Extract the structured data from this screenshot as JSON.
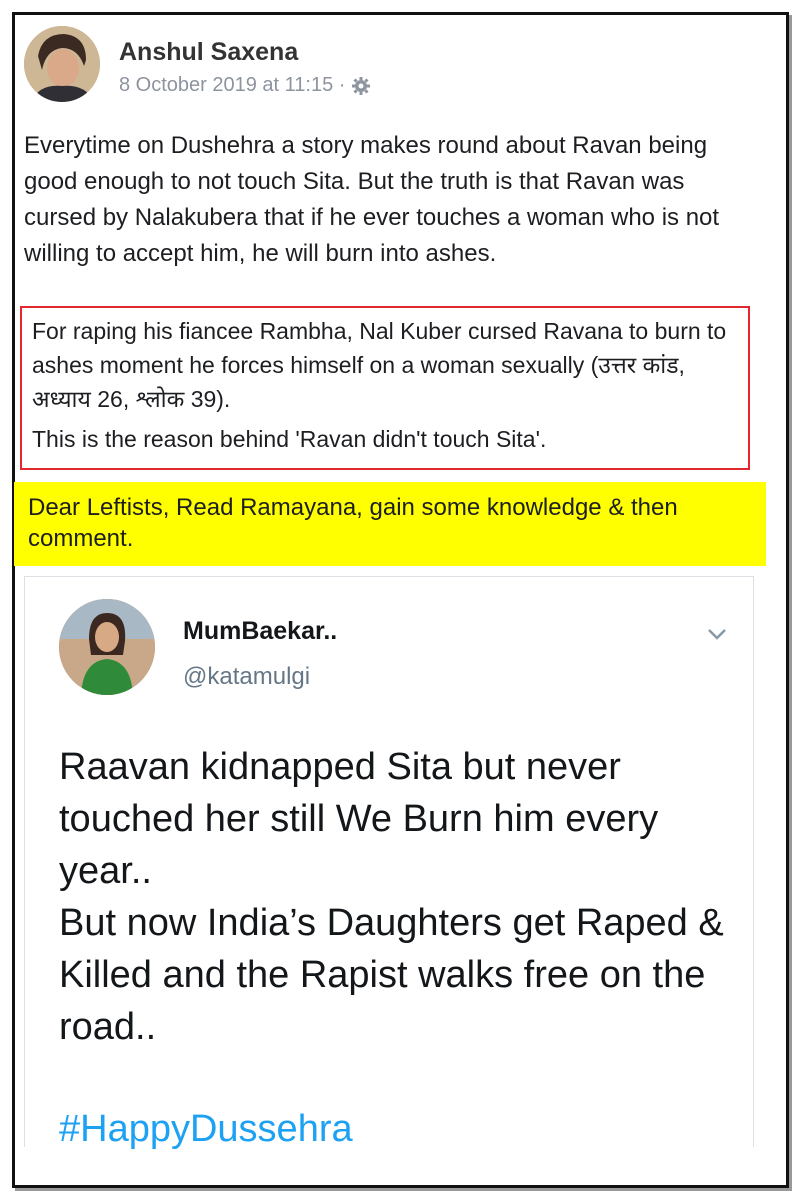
{
  "post": {
    "author": "Anshul Saxena",
    "timestamp": "8 October 2019 at 11:15 ·",
    "audience_icon": "gear-icon",
    "body": "Everytime on Dushehra a story makes round about Ravan being good enough to not touch Sita. But the truth is that Ravan was cursed by Nalakubera that if he ever touches a woman who is not willing to accept him, he will burn into ashes.",
    "boxed_quote": {
      "line1": "For raping his fiancee Rambha, Nal Kuber cursed Ravana to burn to ashes moment he forces himself on a woman sexually (उत्तर कांड, अध्याय 26, श्लोक 39).",
      "line2": "This is the reason behind 'Ravan didn't touch Sita'."
    },
    "highlighted_text": "Dear Leftists, Read Ramayana, gain some knowledge & then comment."
  },
  "embedded_tweet": {
    "display_name": "MumBaekar..",
    "handle": "@katamulgi",
    "menu_icon": "chevron-down-icon",
    "text": "Raavan kidnapped Sita but never touched her still We Burn him every year..\nBut now India’s Daughters get Raped & Killed and the Rapist walks free on the road..",
    "hashtag": "#HappyDussehra"
  },
  "colors": {
    "box_border": "#e0282e",
    "highlight": "#ffff00",
    "hashtag": "#1da1f2",
    "meta_text": "#8d949e"
  }
}
